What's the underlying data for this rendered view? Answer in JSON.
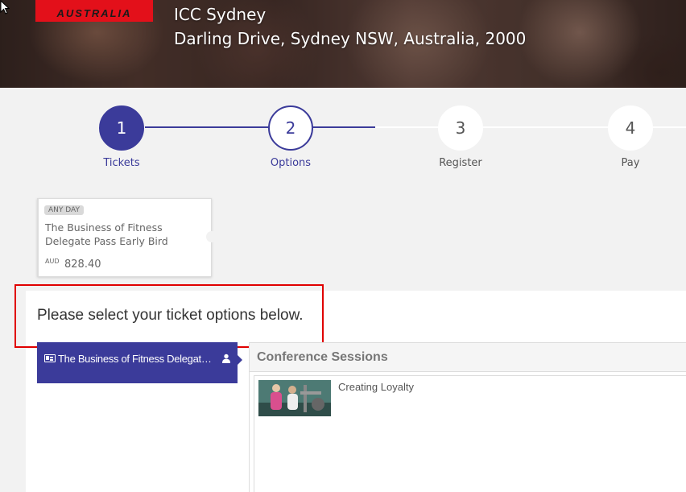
{
  "header": {
    "logo_text": "AUSTRALIA",
    "venue_name": "ICC Sydney",
    "venue_address": "Darling Drive, Sydney NSW, Australia, 2000"
  },
  "stepper": {
    "steps": [
      {
        "number": "1",
        "label": "Tickets",
        "state": "current"
      },
      {
        "number": "2",
        "label": "Options",
        "state": "next"
      },
      {
        "number": "3",
        "label": "Register",
        "state": "future"
      },
      {
        "number": "4",
        "label": "Pay",
        "state": "future"
      }
    ]
  },
  "ticket": {
    "badge": "ANY DAY",
    "name": "The Business of Fitness Delegate Pass Early Bird",
    "currency": "AUD",
    "price": "828.40"
  },
  "options": {
    "heading": "Please select your ticket options below.",
    "tab_label": "The Business of Fitness Delegate Pass Early Bird",
    "sessions_title": "Conference Sessions",
    "session_items": [
      {
        "title": "Creating Loyalty"
      }
    ]
  },
  "colors": {
    "accent": "#3b3b9a",
    "highlight": "#e00000",
    "logo": "#e3101a"
  }
}
